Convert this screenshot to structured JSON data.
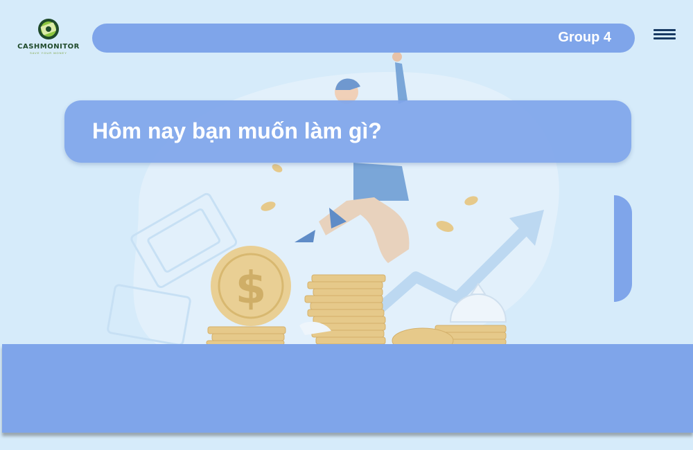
{
  "brand": {
    "name": "CASHMONITOR",
    "tagline": "SAVE YOUR MONEY",
    "logo_icon": "money-circle-icon"
  },
  "header": {
    "group_label": "Group 4",
    "menu_icon": "hamburger-menu-icon"
  },
  "main": {
    "question": "Hôm nay bạn muốn làm gì?"
  },
  "colors": {
    "background": "#d6ebfa",
    "panel_blue": "#7fa5ea",
    "menu_dark": "#183a63",
    "logo_green": "#1f4a2a",
    "coin_gold": "#e6c98a"
  }
}
